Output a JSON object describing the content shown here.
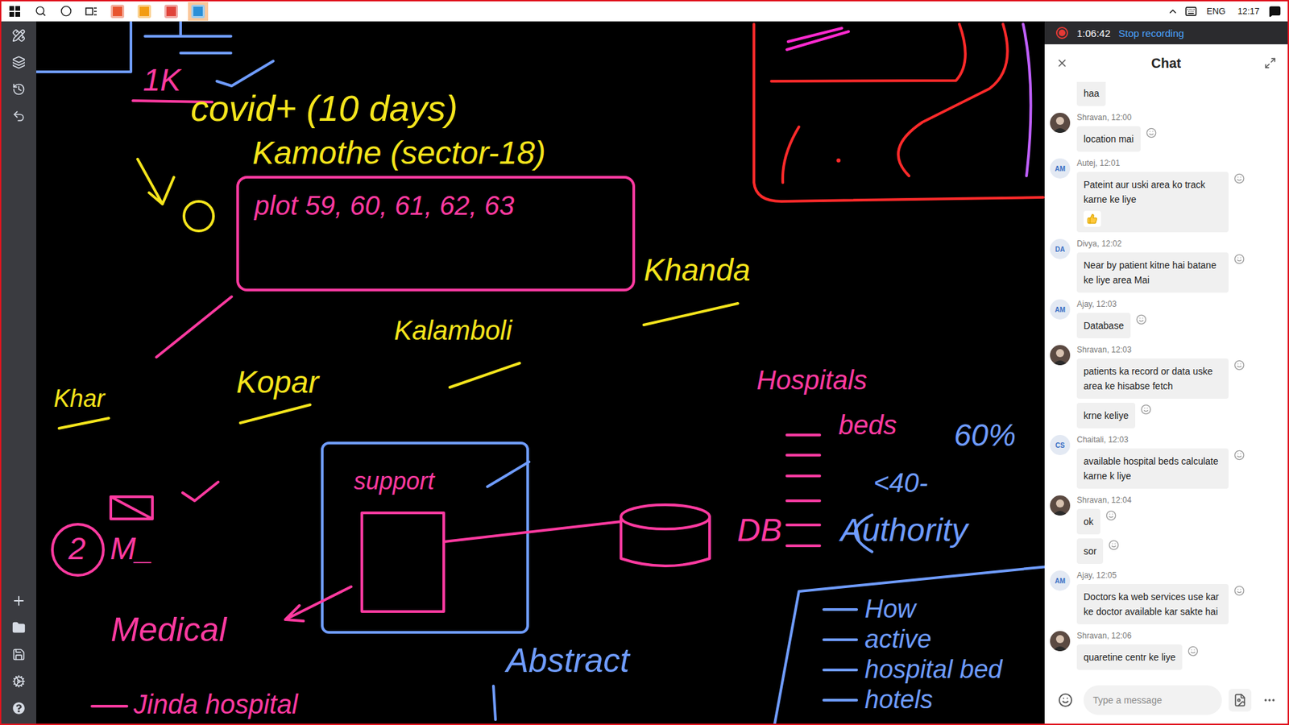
{
  "taskbar": {
    "apps": [
      {
        "color": "#e8552f",
        "selected": false
      },
      {
        "color": "#f39c12",
        "selected": false
      },
      {
        "color": "#e0433a",
        "selected": false
      },
      {
        "color": "#2b8fd6",
        "selected": true
      }
    ],
    "language": "ENG",
    "clock": "12:17"
  },
  "recording": {
    "on": true,
    "elapsed": "1:06:42",
    "action": "Stop recording"
  },
  "chat": {
    "title": "Chat",
    "messages": [
      {
        "kind": "tail",
        "bubbles": [
          {
            "text": "haa",
            "liked": false
          }
        ]
      },
      {
        "kind": "group",
        "meta": "Shravan, 12:00",
        "avatar": {
          "kind": "photo"
        },
        "bubbles": [
          {
            "text": "location mai",
            "liked": false
          }
        ]
      },
      {
        "kind": "group",
        "meta": "Autej, 12:01",
        "avatar": {
          "kind": "initials",
          "initials": "AM"
        },
        "bubbles": [
          {
            "text": "Pateint aur uski area ko track karne ke liye",
            "liked": true
          }
        ]
      },
      {
        "kind": "group",
        "meta": "Divya, 12:02",
        "avatar": {
          "kind": "initials",
          "initials": "DA"
        },
        "bubbles": [
          {
            "text": "Near by patient kitne hai batane ke liye area Mai",
            "liked": false
          }
        ]
      },
      {
        "kind": "group",
        "meta": "Ajay, 12:03",
        "avatar": {
          "kind": "initials",
          "initials": "AM"
        },
        "bubbles": [
          {
            "text": "Database",
            "liked": false
          }
        ]
      },
      {
        "kind": "group",
        "meta": "Shravan, 12:03",
        "avatar": {
          "kind": "photo"
        },
        "bubbles": [
          {
            "text": "patients ka record or data uske area ke hisabse fetch",
            "liked": false
          },
          {
            "text": "krne keliye",
            "liked": false
          }
        ]
      },
      {
        "kind": "group",
        "meta": "Chaitali, 12:03",
        "avatar": {
          "kind": "initials",
          "initials": "CS"
        },
        "bubbles": [
          {
            "text": "available hospital beds calculate karne k liye",
            "liked": false
          }
        ]
      },
      {
        "kind": "group",
        "meta": "Shravan, 12:04",
        "avatar": {
          "kind": "photo"
        },
        "bubbles": [
          {
            "text": "ok",
            "liked": false
          },
          {
            "text": "sor",
            "liked": false
          }
        ]
      },
      {
        "kind": "group",
        "meta": "Ajay, 12:05",
        "avatar": {
          "kind": "initials",
          "initials": "AM"
        },
        "bubbles": [
          {
            "text": "Doctors ka web services use kar ke doctor available kar sakte hai",
            "liked": false
          }
        ]
      },
      {
        "kind": "group",
        "meta": "Shravan, 12:06",
        "avatar": {
          "kind": "photo"
        },
        "bubbles": [
          {
            "text": "quaretine centr ke liye",
            "liked": false
          }
        ]
      }
    ],
    "composer": {
      "placeholder": "Type a message"
    }
  },
  "canvas": {
    "notes": [
      {
        "text": "1K",
        "color": "#ff3aa0"
      },
      {
        "text": "covid+ (10 days)",
        "color": "#f5e51c"
      },
      {
        "text": "Kamothe (sector-18)",
        "color": "#f5e51c"
      },
      {
        "text": "plot 59, 60, 61, 62, 63",
        "color": "#ff3aa0"
      },
      {
        "text": "Khanda",
        "color": "#f5e51c"
      },
      {
        "text": "Kalamboli",
        "color": "#f5e51c"
      },
      {
        "text": "Kopar",
        "color": "#f5e51c"
      },
      {
        "text": "Khar",
        "color": "#f5e51c"
      },
      {
        "text": "Hospitals",
        "color": "#ff3aa0"
      },
      {
        "text": "beds",
        "color": "#ff3aa0"
      },
      {
        "text": "60%",
        "color": "#6f9cff"
      },
      {
        "text": "<40-",
        "color": "#6f9cff"
      },
      {
        "text": "Authority",
        "color": "#6f9cff"
      },
      {
        "text": "DB",
        "color": "#ff3aa0"
      },
      {
        "text": "support",
        "color": "#ff3aa0"
      },
      {
        "text": "2",
        "color": "#ff3aa0"
      },
      {
        "text": "M_",
        "color": "#ff3aa0"
      },
      {
        "text": "Medical",
        "color": "#ff3aa0"
      },
      {
        "text": "Abstract",
        "color": "#6f9cff"
      },
      {
        "text": "How",
        "color": "#6f9cff"
      },
      {
        "text": "active",
        "color": "#6f9cff"
      },
      {
        "text": "hospital bed",
        "color": "#6f9cff"
      },
      {
        "text": "hotels",
        "color": "#6f9cff"
      },
      {
        "text": "Jinda hospital",
        "color": "#ff3aa0"
      }
    ]
  }
}
